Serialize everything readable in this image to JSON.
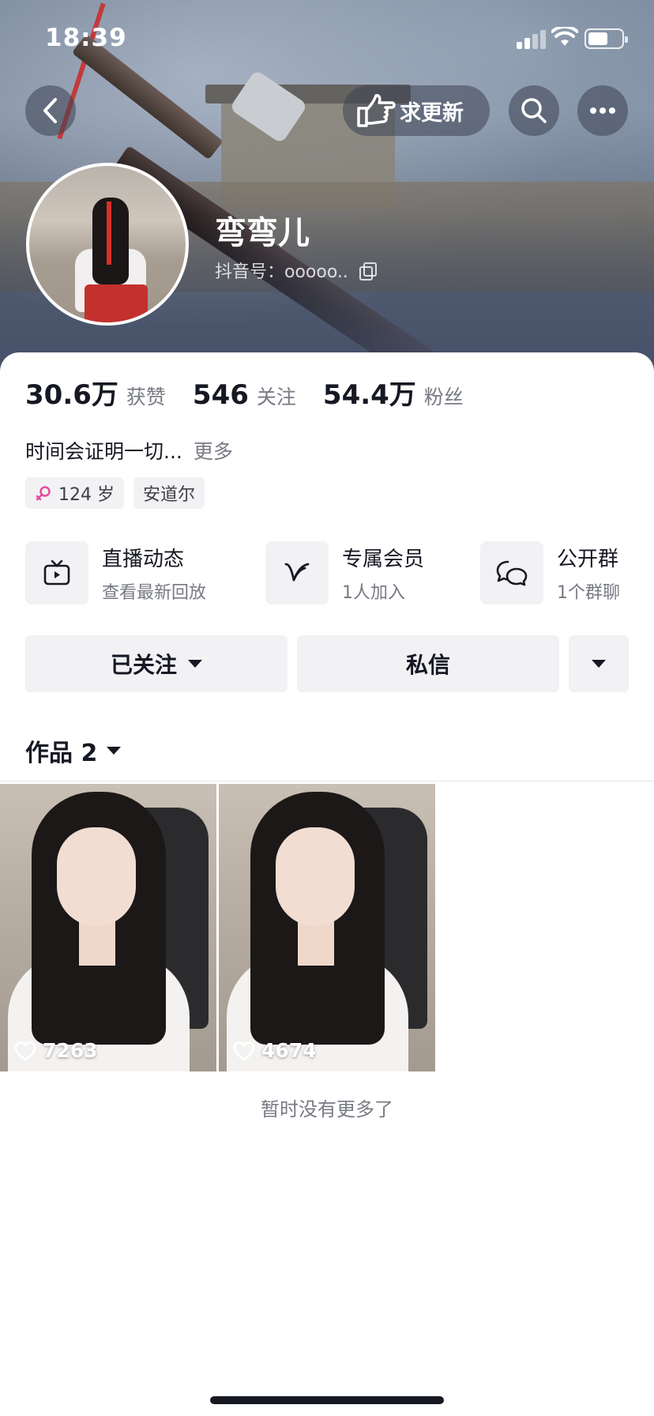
{
  "status_bar": {
    "time": "18:39"
  },
  "nav": {
    "update_label": "求更新"
  },
  "profile": {
    "name": "弯弯儿",
    "douyin_id": "抖音号：ooooo.."
  },
  "stats": [
    {
      "value": "30.6万",
      "label": "获赞"
    },
    {
      "value": "546",
      "label": "关注"
    },
    {
      "value": "54.4万",
      "label": "粉丝"
    }
  ],
  "bio": {
    "text": "时间会证明一切...",
    "more": "更多"
  },
  "tags": {
    "age": "124 岁",
    "location": "安道尔"
  },
  "features": [
    {
      "title": "直播动态",
      "subtitle": "查看最新回放",
      "icon": "tv-icon"
    },
    {
      "title": "专属会员",
      "subtitle": "1人加入",
      "icon": "v-icon"
    },
    {
      "title": "公开群",
      "subtitle": "1个群聊",
      "icon": "chat-icon"
    }
  ],
  "actions": {
    "follow": "已关注",
    "message": "私信"
  },
  "works": {
    "label": "作品 2",
    "items": [
      {
        "likes": "7263"
      },
      {
        "likes": "4674"
      }
    ],
    "end_text": "暂时没有更多了"
  },
  "colors": {
    "text": "#161823",
    "secondary": "#777a83",
    "button_bg": "#f2f2f4",
    "female": "#e8499c"
  }
}
